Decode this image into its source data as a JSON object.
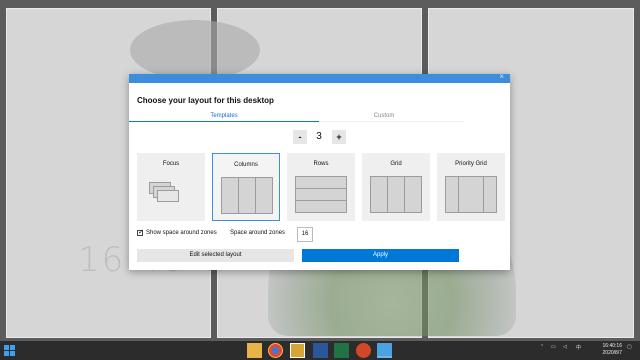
{
  "desktop": {
    "lock_clock": "16:40"
  },
  "dialog": {
    "heading": "Choose your layout for this desktop",
    "close_glyph": "×",
    "tabs": [
      {
        "label": "Templates",
        "active": true
      },
      {
        "label": "Custom",
        "active": false
      }
    ],
    "zone_count": {
      "minus": "-",
      "value": "3",
      "plus": "+"
    },
    "layouts": [
      {
        "label": "Focus",
        "selected": false
      },
      {
        "label": "Columns",
        "selected": true
      },
      {
        "label": "Rows",
        "selected": false
      },
      {
        "label": "Grid",
        "selected": false
      },
      {
        "label": "Priority Grid",
        "selected": false
      }
    ],
    "options": {
      "show_space_label": "Show space around zones",
      "show_space_checked": true,
      "space_label": "Space around zones",
      "space_value": "16"
    },
    "buttons": {
      "edit": "Edit selected layout",
      "apply": "Apply"
    },
    "accent_color": "#0078d7"
  },
  "taskbar": {
    "apps": [
      "file-explorer-icon",
      "chrome-icon",
      "photos-icon",
      "word-icon",
      "excel-icon",
      "powerpoint-icon",
      "fancyzones-icon"
    ],
    "tray_ime": "中",
    "time": "16:40:16",
    "date": "2020/8/7"
  }
}
